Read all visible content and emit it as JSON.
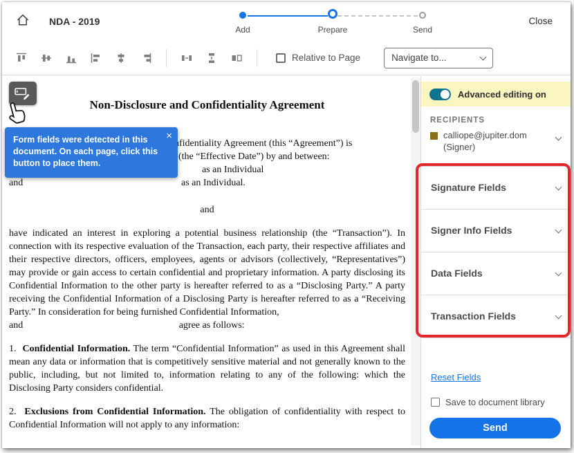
{
  "colors": {
    "accent_blue": "#1473E6",
    "toggle_on": "#0E7490",
    "annotation_red": "#E2262C",
    "highlight_yellow": "#FBF6C0",
    "tooltip_blue": "#2D77DD",
    "recipient_swatch": "#8A6D1B"
  },
  "icons": {
    "home-icon": "house-outline",
    "align-top-icon": "align-top",
    "align-middle-icon": "align-vertical-center",
    "align-bottom-icon": "align-bottom",
    "align-left-icon": "align-left",
    "align-center-icon": "align-horizontal-center",
    "align-right-icon": "align-right",
    "distribute-horizontal-icon": "distribute-horizontally",
    "distribute-vertical-icon": "distribute-vertically",
    "match-size-icon": "match-field-size",
    "form-field-icon": "text-field-with-pencil",
    "hand-cursor": "pointing-hand",
    "chevron-down-icon": "chevron-down"
  },
  "header": {
    "title": "NDA - 2019",
    "close": "Close",
    "steps": [
      {
        "label": "Add",
        "state": "done"
      },
      {
        "label": "Prepare",
        "state": "current"
      },
      {
        "label": "Send",
        "state": "todo"
      }
    ]
  },
  "toolbar": {
    "relative_to_page": "Relative to Page",
    "navigate_to": "Navigate to..."
  },
  "doc_overlay": {
    "tooltip_text": "Form fields were detected in this document. On each page, click this button to place them.",
    "tooltip_close": "×"
  },
  "document": {
    "title": "Non-Disclosure and Confidentiality Agreement",
    "intro": [
      "nfidentiality Agreement (this “Agreement”) is",
      "(the “Effective Date”) by and between:",
      "as an Individual",
      "and",
      "as an Individual."
    ],
    "and_center": "and",
    "body": "have indicated an interest in exploring a potential business relationship (the “Transaction”). In connection with its respective evaluation of the Transaction, each party, their respective affiliates and their respective directors, officers, employees, agents or advisors (collectively, “Representatives”) may provide or gain access to certain confidential and proprietary information. A party disclosing its Confidential Information to the other party is hereafter referred to as a “Disclosing Party.” A party receiving the Confidential Information of a Disclosing Party is hereafter referred to as a “Receiving Party.” In consideration for being furnished Confidential Information,",
    "and_agree_left": "and",
    "and_agree_right": "agree as follows:",
    "clauses": [
      {
        "num": "1.",
        "title": "Confidential Information.",
        "text": " The term “Confidential Information” as used in this Agreement shall mean any data or information that is competitively sensitive material and not generally known to the public, including, but not limited to, information relating to any of the following: which the Disclosing Party considers confidential."
      },
      {
        "num": "2.",
        "title": "Exclusions from Confidential Information.",
        "text": " The obligation of confidentiality with respect to Confidential Information will not apply to any information:"
      }
    ]
  },
  "panel": {
    "advanced_editing": "Advanced editing on",
    "recipients_title": "RECIPIENTS",
    "recipient_email": "calliope@jupiter.dom",
    "recipient_role": "(Signer)",
    "sections": [
      {
        "label": "Signature Fields"
      },
      {
        "label": "Signer Info Fields"
      },
      {
        "label": "Data Fields"
      },
      {
        "label": "Transaction Fields"
      }
    ],
    "reset_link": "Reset Fields",
    "save_label": "Save to document library",
    "send_label": "Send"
  }
}
